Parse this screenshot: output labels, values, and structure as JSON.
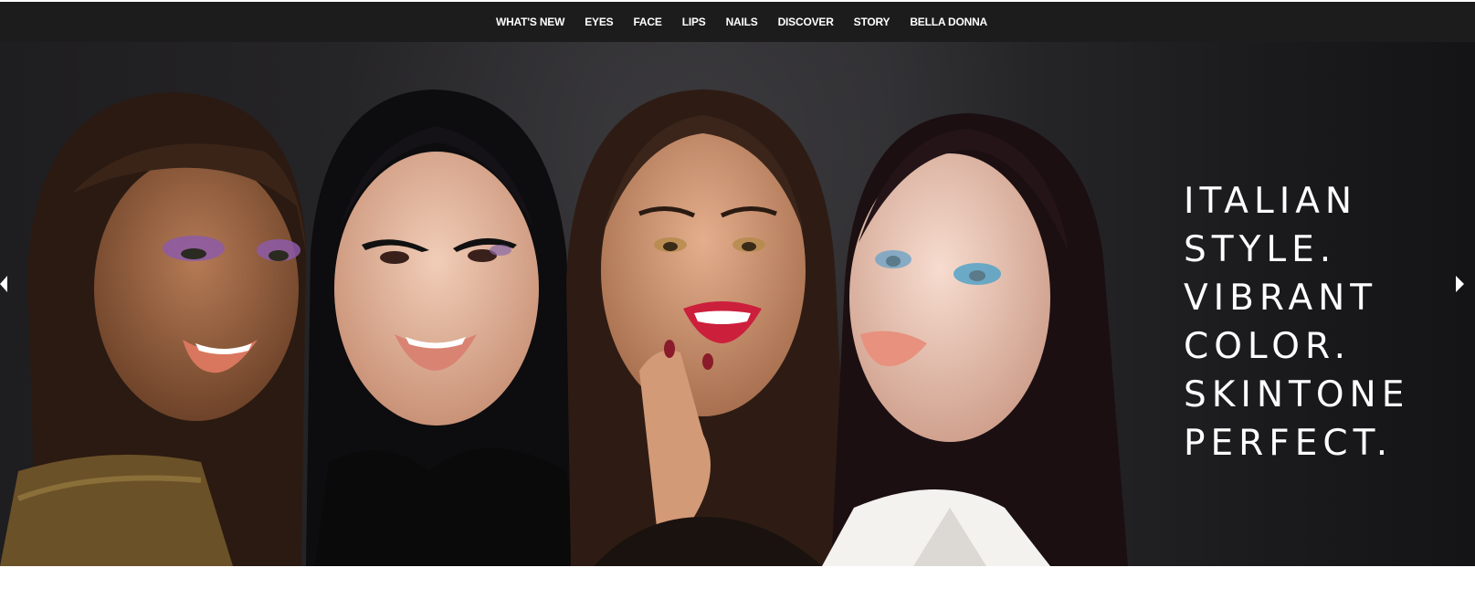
{
  "nav": {
    "items": [
      {
        "label": "WHAT'S NEW"
      },
      {
        "label": "EYES"
      },
      {
        "label": "FACE"
      },
      {
        "label": "LIPS"
      },
      {
        "label": "NAILS"
      },
      {
        "label": "DISCOVER"
      },
      {
        "label": "STORY"
      },
      {
        "label": "BELLA DONNA"
      }
    ]
  },
  "hero": {
    "headline_lines": [
      "ITALIAN",
      "STYLE.",
      "VIBRANT",
      "COLOR.",
      "SKINTONE",
      "PERFECT."
    ],
    "prev_icon": "triangle-left-icon",
    "next_icon": "triangle-right-icon"
  },
  "colors": {
    "nav_bg": "#1c1c1c",
    "hero_bg": "#29282b",
    "text": "#ffffff"
  }
}
